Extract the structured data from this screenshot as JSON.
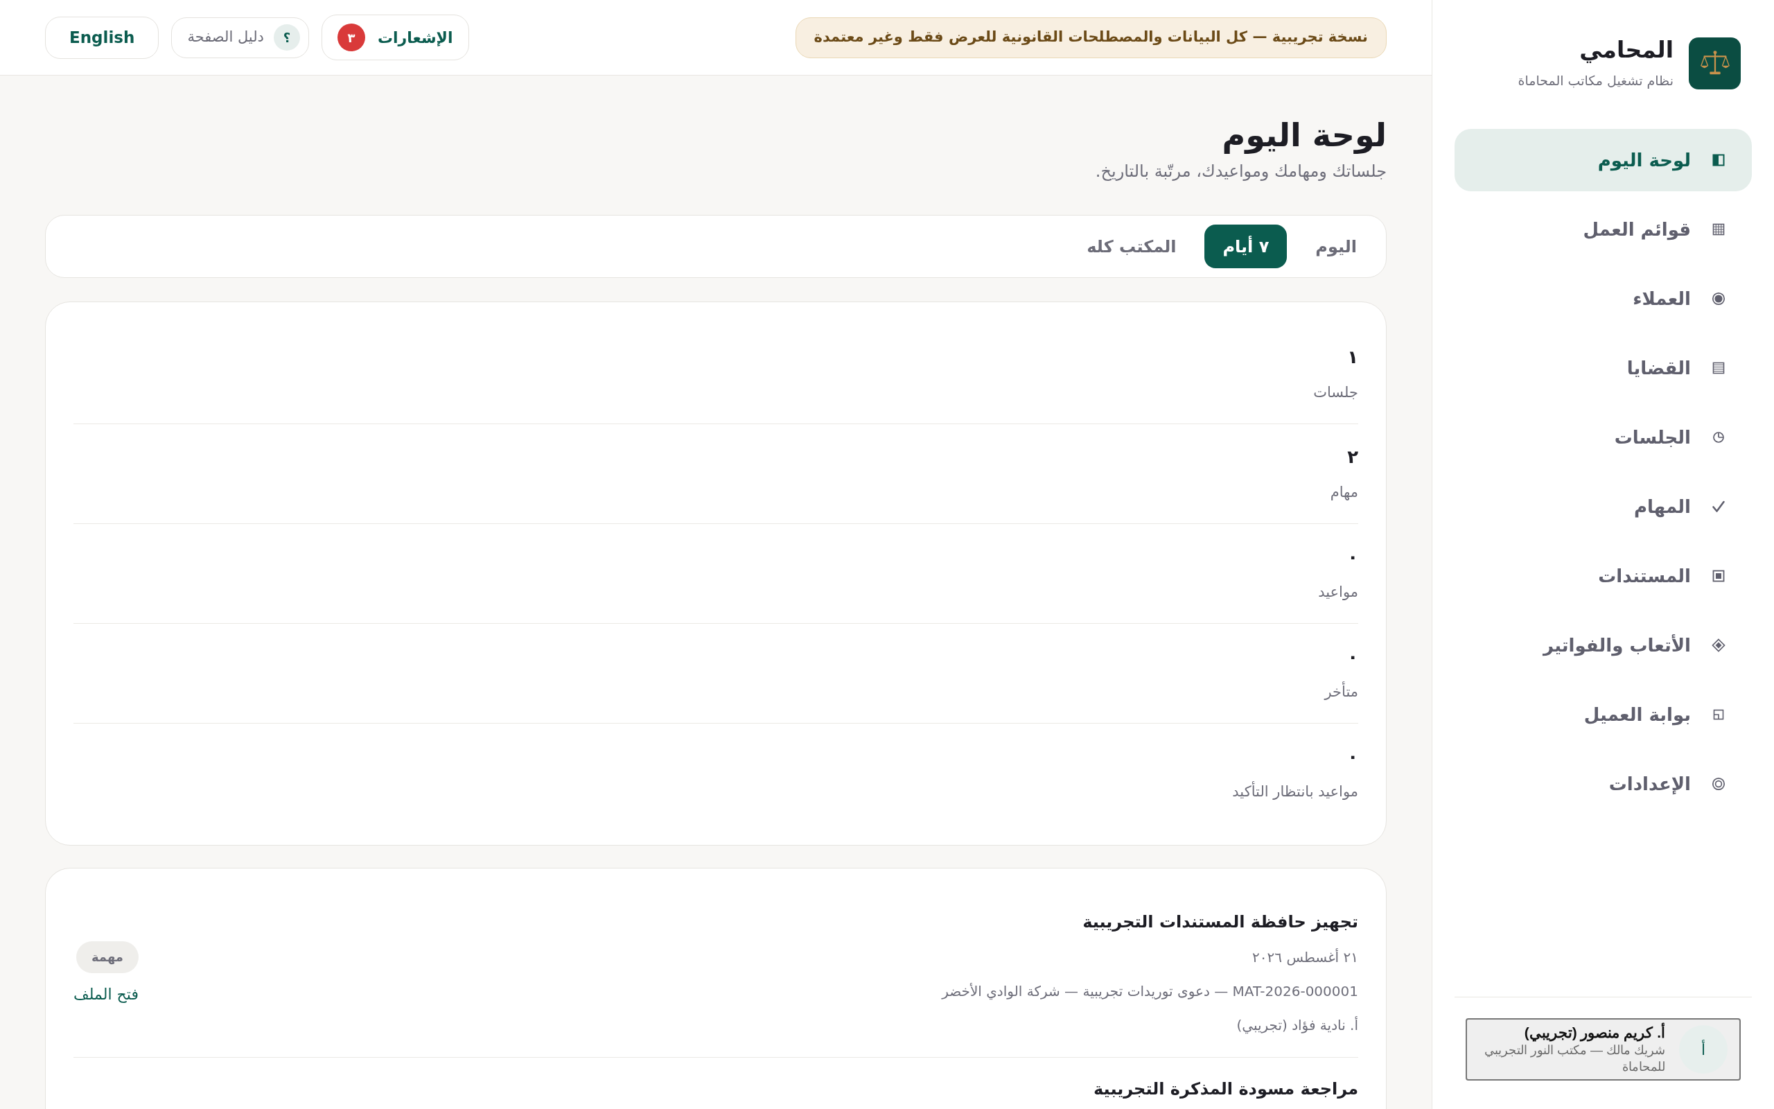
{
  "sidebar": {
    "brand": {
      "title": "المحامي",
      "subtitle": "نظام تشغيل مكاتب المحاماة"
    },
    "nav": [
      {
        "label": "لوحة اليوم",
        "selected": true
      },
      {
        "label": "قوائم العمل",
        "selected": false
      },
      {
        "label": "العملاء",
        "selected": false
      },
      {
        "label": "القضايا",
        "selected": false
      },
      {
        "label": "الجلسات",
        "selected": false
      },
      {
        "label": "المهام",
        "selected": false
      },
      {
        "label": "المستندات",
        "selected": false
      },
      {
        "label": "الأتعاب والفواتير",
        "selected": false
      },
      {
        "label": "بوابة العميل",
        "selected": false
      },
      {
        "label": "الإعدادات",
        "selected": false
      }
    ],
    "user": {
      "avatar": "أ",
      "name": "أ. كريم منصور (تجريبي)",
      "role": "شريك مالك — مكتب النور التجريبي للمحاماة"
    }
  },
  "topbar": {
    "notice": "نسخة تجريبية — كل البيانات والمصطلحات القانونية للعرض فقط وغير معتمدة",
    "notifications": {
      "label": "الإشعارات",
      "count": "٣"
    },
    "guide": {
      "icon": "؟",
      "label": "دليل الصفحة"
    },
    "language": "English"
  },
  "page": {
    "title": "لوحة اليوم",
    "subtitle": "جلساتك ومهامك ومواعيدك، مرتّبة بالتاريخ."
  },
  "tabs": [
    {
      "label": "اليوم",
      "selected": false
    },
    {
      "label": "٧ أيام",
      "selected": true
    },
    {
      "label": "المكتب كله",
      "selected": false
    }
  ],
  "stats": [
    {
      "value": "١",
      "label": "جلسات"
    },
    {
      "value": "٢",
      "label": "مهام"
    },
    {
      "value": "٠",
      "label": "مواعيد"
    },
    {
      "value": "٠",
      "label": "متأخر"
    },
    {
      "value": "٠",
      "label": "مواعيد بانتظار التأكيد"
    }
  ],
  "agenda": [
    {
      "title": "تجهيز حافظة المستندات التجريبية",
      "date": "٢١ أغسطس ٢٠٢٦",
      "matter": "MAT-2026-000001 — دعوى توريدات تجريبية — شركة الوادي الأخضر",
      "assignee": "أ. نادية فؤاد (تجريبي)",
      "type": "مهمة",
      "link": "فتح الملف"
    },
    {
      "title": "مراجعة مسودة المذكرة التجريبية"
    }
  ]
}
